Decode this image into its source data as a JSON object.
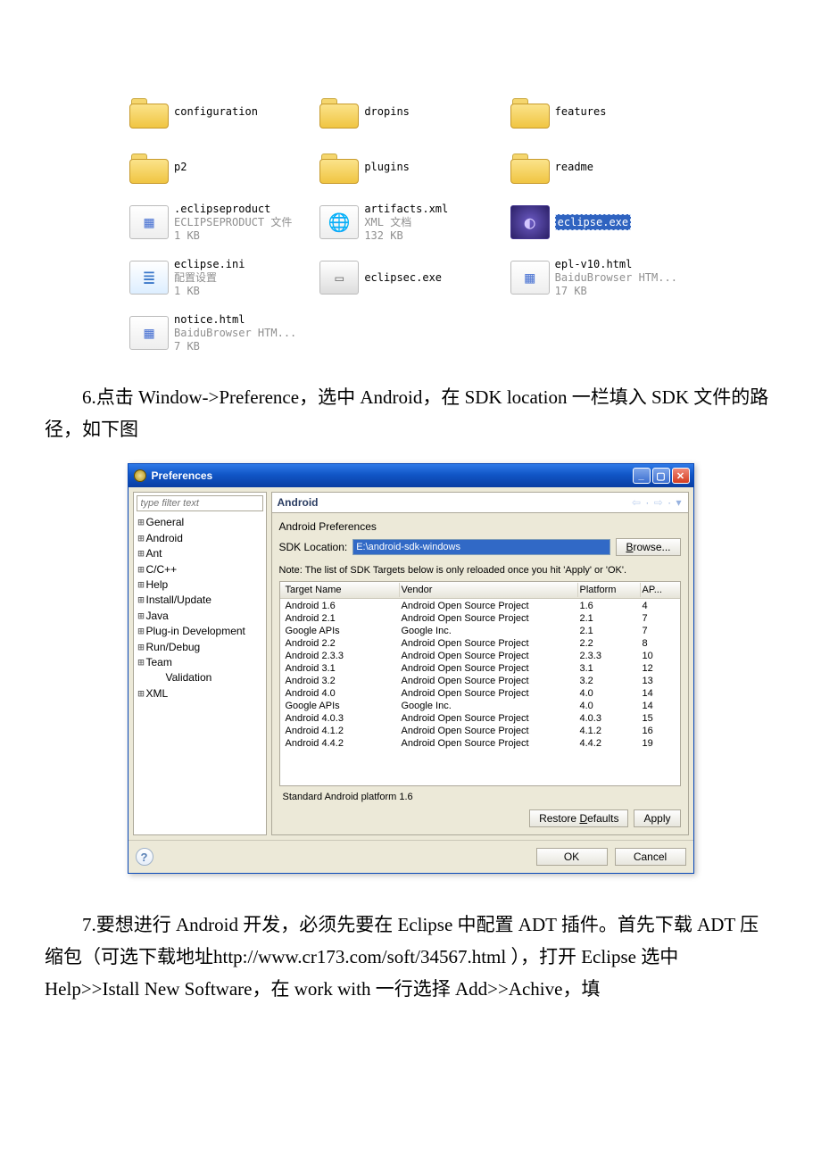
{
  "file_browser": {
    "items": [
      {
        "name": "configuration",
        "type": "folder"
      },
      {
        "name": "dropins",
        "type": "folder"
      },
      {
        "name": "features",
        "type": "folder"
      },
      {
        "name": "p2",
        "type": "folder"
      },
      {
        "name": "plugins",
        "type": "folder"
      },
      {
        "name": "readme",
        "type": "folder"
      },
      {
        "name": ".eclipseproduct",
        "sub1": "ECLIPSEPRODUCT 文件",
        "sub2": "1 KB",
        "icon": "blocks"
      },
      {
        "name": "artifacts.xml",
        "sub1": "XML 文档",
        "sub2": "132 KB",
        "icon": "globe"
      },
      {
        "name": "eclipse.exe",
        "selected": true,
        "icon": "eclipse-exe"
      },
      {
        "name": "eclipse.ini",
        "sub1": "配置设置",
        "sub2": "1 KB",
        "icon": "ini"
      },
      {
        "name": "eclipsec.exe",
        "icon": "exe"
      },
      {
        "name": "epl-v10.html",
        "sub1": "BaiduBrowser HTM...",
        "sub2": "17 KB",
        "icon": "blocks"
      },
      {
        "name": "notice.html",
        "sub1": "BaiduBrowser HTM...",
        "sub2": "7 KB",
        "icon": "blocks"
      }
    ]
  },
  "paragraph6": "6.点击 Window->Preference，选中 Android，在 SDK location 一栏填入 SDK 文件的路径，如下图",
  "paragraph7": "7.要想进行 Android 开发，必须先要在 Eclipse 中配置 ADT 插件。首先下载 ADT 压缩包（可选下载地址http://www.cr173.com/soft/34567.html ），打开 Eclipse 选中 Help>>Istall New Software，在 work with 一行选择 Add>>Achive，填",
  "dialog": {
    "title": "Preferences",
    "filter_placeholder": "type filter text",
    "tree": [
      {
        "label": "General",
        "exp": true
      },
      {
        "label": "Android",
        "exp": true
      },
      {
        "label": "Ant",
        "exp": true
      },
      {
        "label": "C/C++",
        "exp": true
      },
      {
        "label": "Help",
        "exp": true
      },
      {
        "label": "Install/Update",
        "exp": true
      },
      {
        "label": "Java",
        "exp": true
      },
      {
        "label": "Plug-in Development",
        "exp": true
      },
      {
        "label": "Run/Debug",
        "exp": true
      },
      {
        "label": "Team",
        "exp": true
      },
      {
        "label": "Validation",
        "child": true
      },
      {
        "label": "XML",
        "exp": true
      }
    ],
    "banner_title": "Android",
    "pref_label": "Android Preferences",
    "sdk_label": "SDK Location:",
    "sdk_value": "E:\\android-sdk-windows",
    "browse_btn": "Browse...",
    "note": "Note: The list of SDK Targets below is only reloaded once you hit 'Apply' or 'OK'.",
    "columns": [
      "Target Name",
      "Vendor",
      "Platform",
      "AP..."
    ],
    "rows": [
      [
        "Android 1.6",
        "Android Open Source Project",
        "1.6",
        "4"
      ],
      [
        "Android 2.1",
        "Android Open Source Project",
        "2.1",
        "7"
      ],
      [
        "Google APIs",
        "Google Inc.",
        "2.1",
        "7"
      ],
      [
        "Android 2.2",
        "Android Open Source Project",
        "2.2",
        "8"
      ],
      [
        "Android 2.3.3",
        "Android Open Source Project",
        "2.3.3",
        "10"
      ],
      [
        "Android 3.1",
        "Android Open Source Project",
        "3.1",
        "12"
      ],
      [
        "Android 3.2",
        "Android Open Source Project",
        "3.2",
        "13"
      ],
      [
        "Android 4.0",
        "Android Open Source Project",
        "4.0",
        "14"
      ],
      [
        "Google APIs",
        "Google Inc.",
        "4.0",
        "14"
      ],
      [
        "Android 4.0.3",
        "Android Open Source Project",
        "4.0.3",
        "15"
      ],
      [
        "Android 4.1.2",
        "Android Open Source Project",
        "4.1.2",
        "16"
      ],
      [
        "Android 4.4.2",
        "Android Open Source Project",
        "4.4.2",
        "19"
      ]
    ],
    "status": "Standard Android platform 1.6",
    "restore_btn": "Restore Defaults",
    "apply_btn": "Apply",
    "ok_btn": "OK",
    "cancel_btn": "Cancel"
  }
}
